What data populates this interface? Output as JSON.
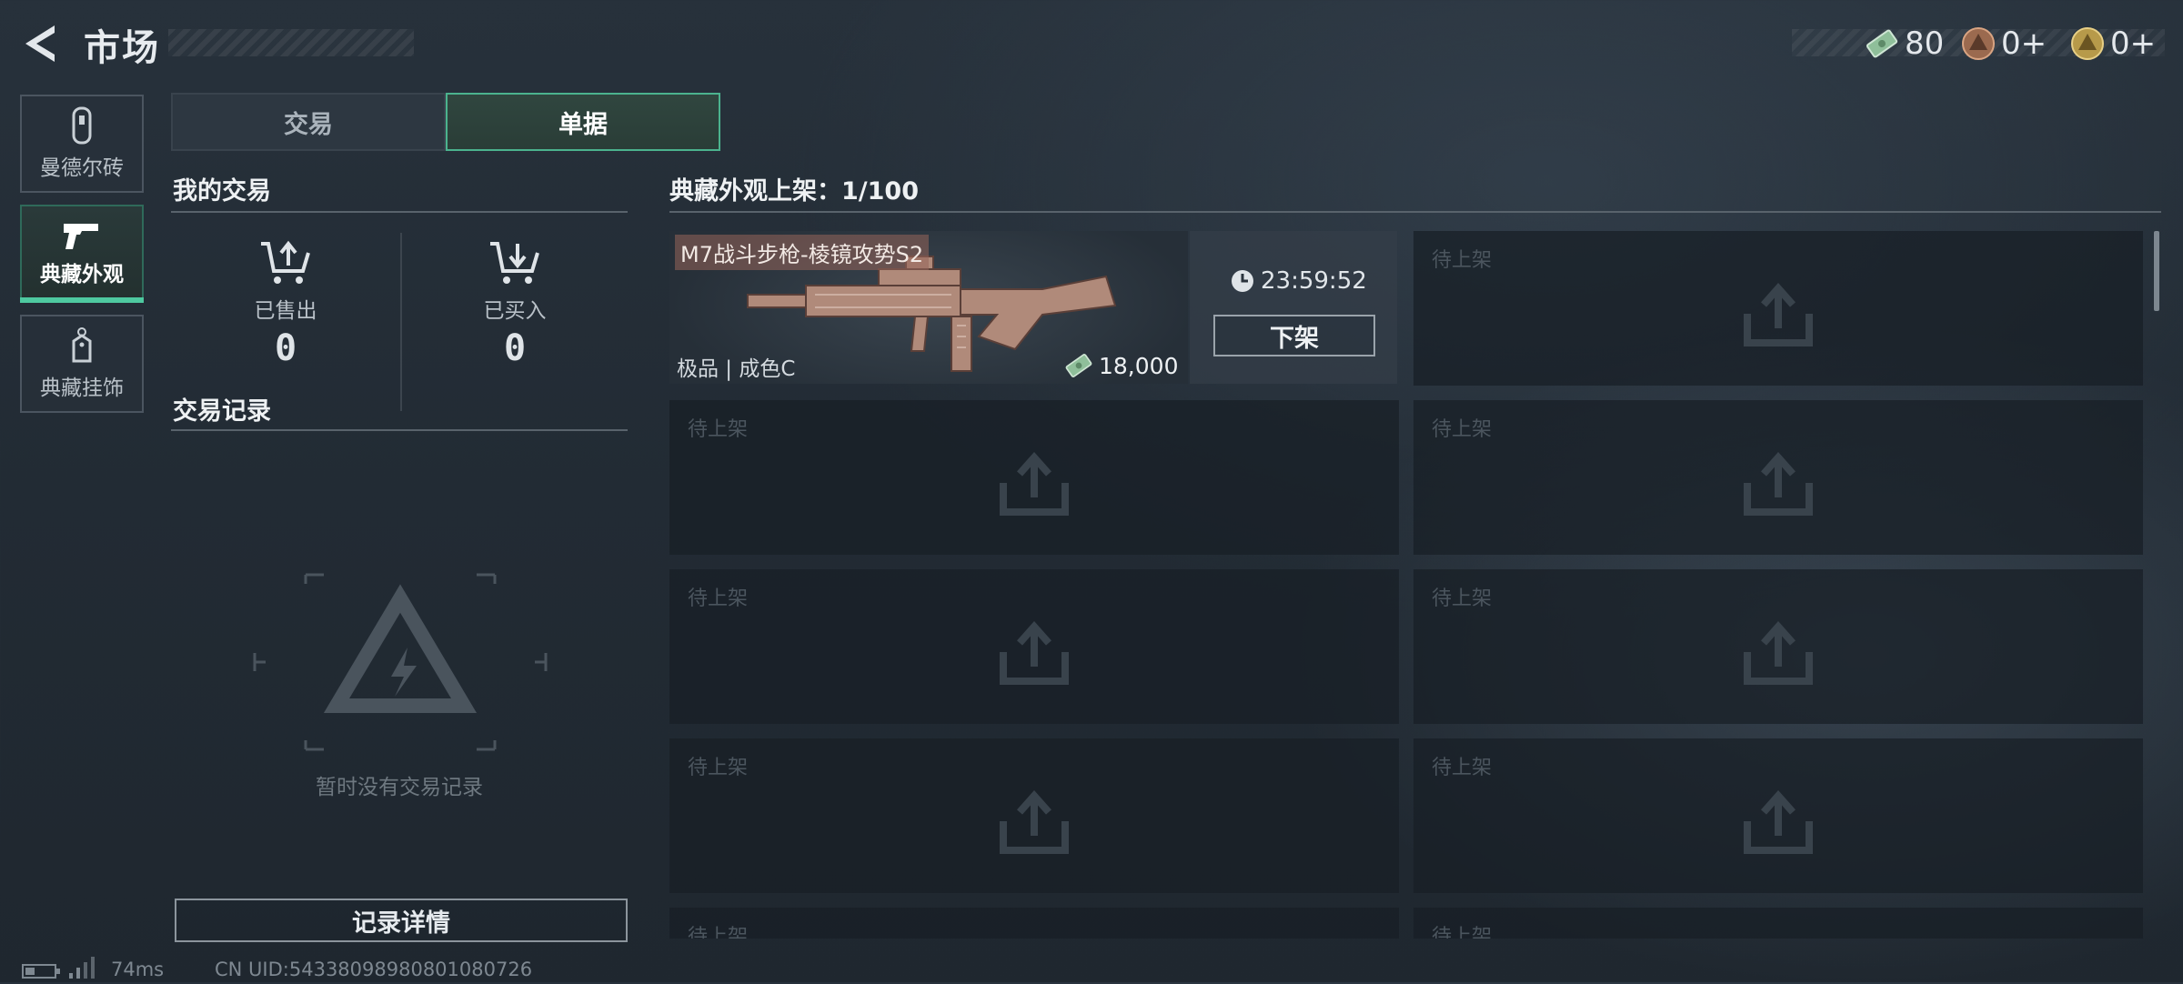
{
  "header": {
    "title": "市场",
    "currencies": [
      {
        "icon": "cash-voucher-icon",
        "value": "80"
      },
      {
        "icon": "bronze-coin-icon",
        "value": "0+"
      },
      {
        "icon": "gold-coin-icon",
        "value": "0+"
      }
    ]
  },
  "sidebar": {
    "items": [
      {
        "label": "曼德尔砖",
        "icon": "mandel-brick-icon",
        "active": false
      },
      {
        "label": "典藏外观",
        "icon": "pistol-icon",
        "active": true
      },
      {
        "label": "典藏挂饰",
        "icon": "charm-tag-icon",
        "active": false
      }
    ]
  },
  "tabs": {
    "trade": "交易",
    "orders": "单据"
  },
  "my_trades": {
    "title": "我的交易",
    "sold_label": "已售出",
    "sold_value": "0",
    "bought_label": "已买入",
    "bought_value": "0"
  },
  "trade_records": {
    "title": "交易记录",
    "empty_text": "暂时没有交易记录",
    "detail_button": "记录详情"
  },
  "listings": {
    "title": "典藏外观上架：1/100",
    "item": {
      "name": "M7战斗步枪-棱镜攻势S2",
      "grade": "极品 | 成色C",
      "price": "18,000",
      "timer": "23:59:52",
      "delist_button": "下架"
    },
    "empty_slot_label": "待上架"
  },
  "status_bar": {
    "ping": "74ms",
    "uid": "CN UID:54338098980801080726"
  },
  "colors": {
    "accent": "#4ec9a0",
    "background": "#232c35"
  }
}
